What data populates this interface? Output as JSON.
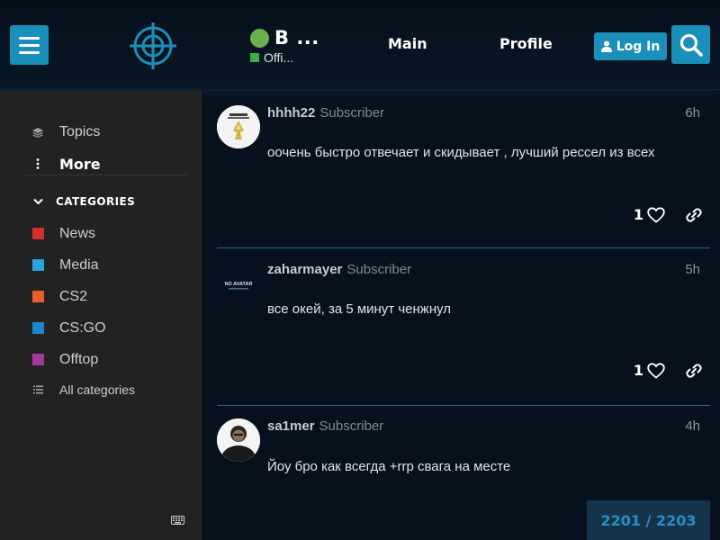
{
  "header": {
    "site_title": "B ...",
    "site_subtitle": "Offi...",
    "nav": [
      "Main",
      "Profile"
    ],
    "login_label": "Log In",
    "accent": "#1a8fb9",
    "status_color": "#6ab04c"
  },
  "sidebar": {
    "topics_label": "Topics",
    "more_label": "More",
    "categories_heading": "CATEGORIES",
    "categories": [
      {
        "name": "News",
        "color": "#d32f2f"
      },
      {
        "name": "Media",
        "color": "#29a3dc"
      },
      {
        "name": "CS2",
        "color": "#e4622a"
      },
      {
        "name": "CS:GO",
        "color": "#1c86c8"
      },
      {
        "name": "Offtop",
        "color": "#a23a9b"
      }
    ],
    "all_categories_label": "All categories"
  },
  "posts": [
    {
      "username": "hhhh22",
      "user_title": "Subscriber",
      "time": "6h",
      "text": "оочень быстро отвечает и скидывает , лучший рессел из всех",
      "likes": "1"
    },
    {
      "username": "zaharmayer",
      "user_title": "Subscriber",
      "time": "5h",
      "text": "все окей, за 5 минут ченжнул",
      "likes": "1",
      "avatar_text": "NO AVATAR"
    },
    {
      "username": "sa1mer",
      "user_title": "Subscriber",
      "time": "4h",
      "text": "Йоу бро как всегда +rrp свага на месте"
    }
  ],
  "progress": {
    "label": "2201 / 2203"
  }
}
